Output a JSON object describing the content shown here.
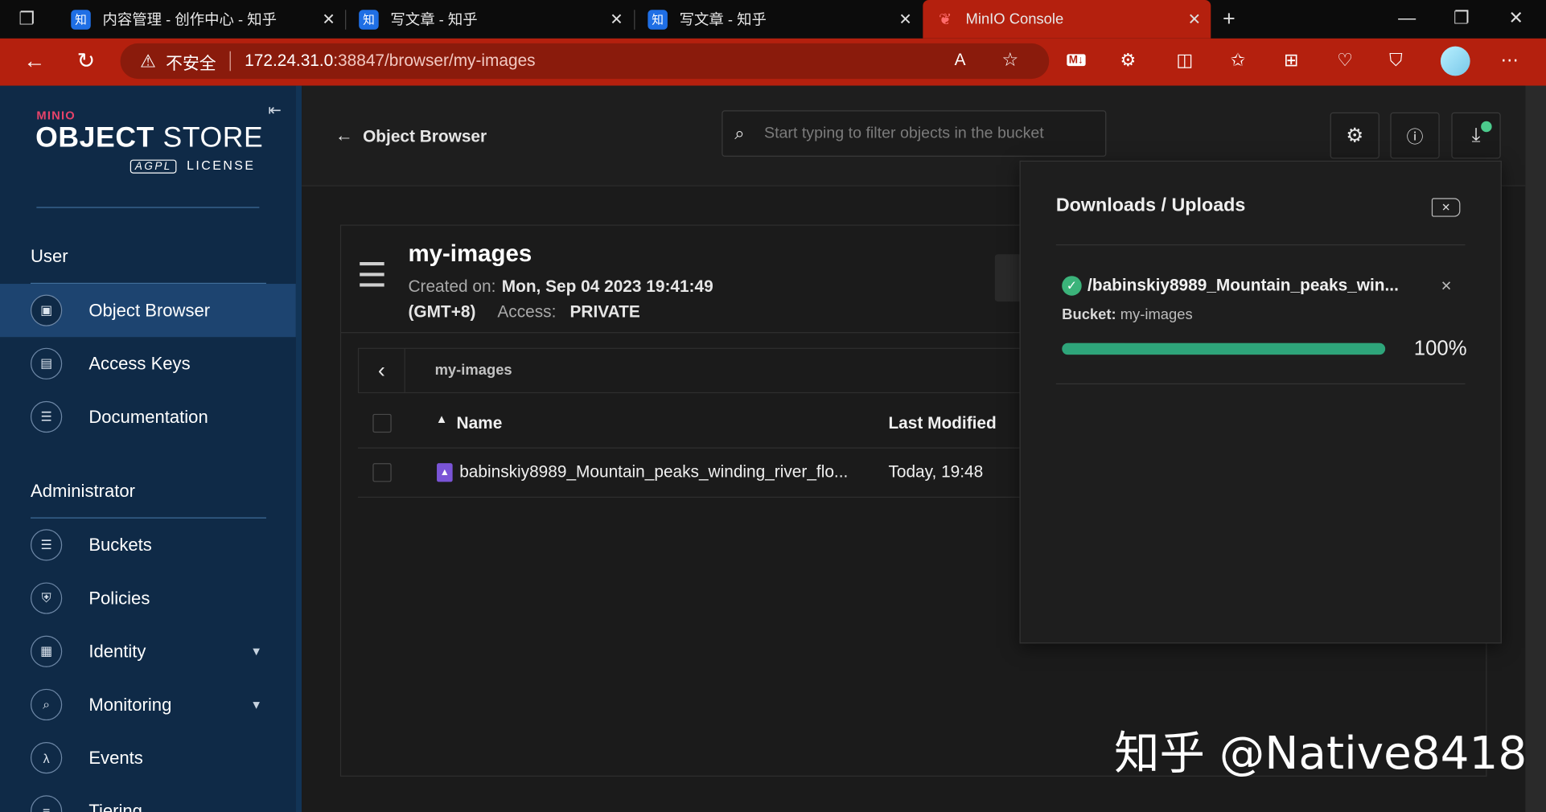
{
  "browser": {
    "tabs": [
      {
        "label": "内容管理 - 创作中心 - 知乎",
        "favicon": "知"
      },
      {
        "label": "写文章 - 知乎",
        "favicon": "知"
      },
      {
        "label": "写文章 - 知乎",
        "favicon": "知"
      },
      {
        "label": "MinIO Console",
        "favicon": ""
      }
    ],
    "security_label": "不安全",
    "url_host": "172.24.31.0",
    "url_path": ":38847/browser/my-images"
  },
  "sidebar": {
    "logo_brand": "MINIO",
    "logo_product_bold": "OBJECT",
    "logo_product": "STORE",
    "logo_badge": "AGPL",
    "logo_license": "LICENSE",
    "user_heading": "User",
    "user_items": [
      {
        "label": "Object Browser",
        "icon": "object-browser-icon"
      },
      {
        "label": "Access Keys",
        "icon": "access-keys-icon"
      },
      {
        "label": "Documentation",
        "icon": "documentation-icon"
      }
    ],
    "admin_heading": "Administrator",
    "admin_items": [
      {
        "label": "Buckets",
        "icon": "bucket-icon"
      },
      {
        "label": "Policies",
        "icon": "policy-shield-icon"
      },
      {
        "label": "Identity",
        "icon": "identity-card-icon"
      },
      {
        "label": "Monitoring",
        "icon": "monitoring-icon"
      },
      {
        "label": "Events",
        "icon": "lambda-icon"
      },
      {
        "label": "Tiering",
        "icon": "tiering-icon"
      }
    ]
  },
  "header": {
    "title": "Object Browser",
    "search_placeholder": "Start typing to filter objects in the bucket"
  },
  "bucket": {
    "name": "my-images",
    "created_label": "Created on:",
    "created_value": "Mon, Sep 04 2023 19:41:49",
    "timezone": "(GMT+8)",
    "access_label": "Access:",
    "access_value": "PRIVATE",
    "breadcrumb": "my-images"
  },
  "table": {
    "columns": [
      "Name",
      "Last Modified"
    ],
    "rows": [
      {
        "name": "babinskiy8989_Mountain_peaks_winding_river_flo...",
        "modified": "Today, 19:48"
      }
    ]
  },
  "downloads": {
    "title": "Downloads / Uploads",
    "item_file": "/babinskiy8989_Mountain_peaks_win...",
    "bucket_label": "Bucket:",
    "bucket_value": "my-images",
    "progress": 100,
    "progress_text": "100%"
  },
  "watermark": "知乎 @Native8418",
  "colors": {
    "sidebar_bg": "#0f2a47",
    "browser_accent": "#b4200e",
    "progress_fill": "#2ea57a",
    "success_green": "#3bb37a"
  }
}
